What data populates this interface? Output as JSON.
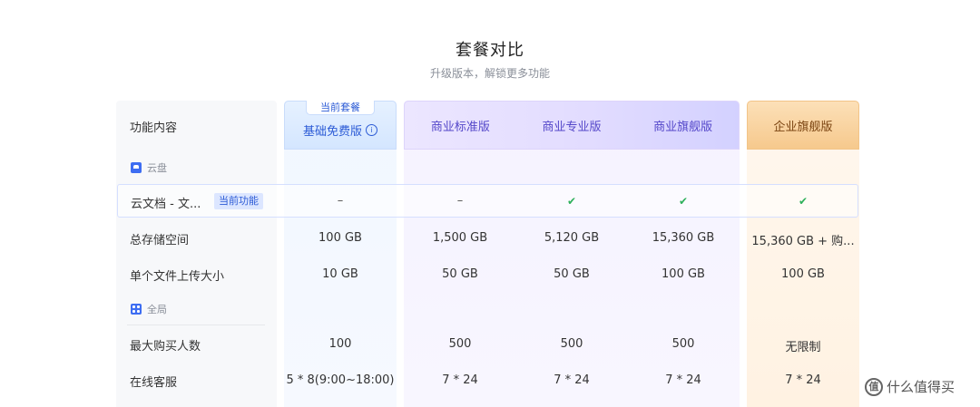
{
  "page": {
    "title": "套餐对比",
    "subtitle": "升级版本，解锁更多功能"
  },
  "header": {
    "feature_label": "功能内容",
    "current_badge": "当前套餐",
    "plans": [
      "基础免费版",
      "商业标准版",
      "商业专业版",
      "商业旗舰版",
      "企业旗舰版"
    ]
  },
  "sections": {
    "cloud": "云盘",
    "global": "全局"
  },
  "highlight_row": {
    "label": "云文档 - 文...",
    "tag": "当前功能",
    "values": [
      "–",
      "–",
      "✔",
      "✔",
      "✔"
    ]
  },
  "rows": [
    {
      "label": "总存储空间",
      "values": [
        "100 GB",
        "1,500 GB",
        "5,120 GB",
        "15,360 GB",
        "15,360 GB + 购..."
      ]
    },
    {
      "label": "单个文件上传大小",
      "values": [
        "10 GB",
        "50 GB",
        "50 GB",
        "100 GB",
        "100 GB"
      ]
    },
    {
      "label": "最大购买人数",
      "values": [
        "100",
        "500",
        "500",
        "500",
        "无限制"
      ]
    },
    {
      "label": "在线客服",
      "values": [
        "5 * 8(9:00~18:00)",
        "7 * 24",
        "7 * 24",
        "7 * 24",
        "7 * 24"
      ]
    }
  ],
  "watermark": "什么值得买",
  "colors": {
    "accent_blue": "#2c5bd6",
    "business_purple": "#5447c9",
    "enterprise_orange": "#f6c98d",
    "check_green": "#2eb05b"
  }
}
